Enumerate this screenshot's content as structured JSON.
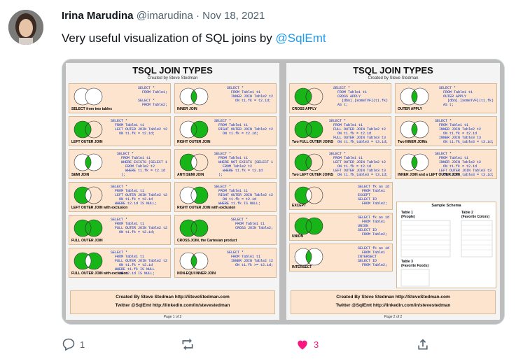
{
  "tweet": {
    "author_name": "Irina Marudina",
    "handle": "@imarudina",
    "dot": "·",
    "date": "Nov 18, 2021",
    "text_prefix": "Very useful visualization of SQL joins by ",
    "mention": "@SqlEmt"
  },
  "image": {
    "page1": {
      "title": "TSQL JOIN TYPES",
      "subtitle": "Created by Steve Stedman",
      "panels": [
        {
          "caption": "SELECT from two tables",
          "code": "SELECT *\n  FROM Table1;\n\nSELECT *\n  FROM Table2;"
        },
        {
          "caption": "INNER JOIN",
          "code": "SELECT *\n  FROM Table1 t1\n  INNER JOIN Table2 t2\n    ON t1.fk = t2.id;"
        },
        {
          "caption": "LEFT OUTER JOIN",
          "code": "SELECT *\n  FROM Table1 t1\n  LEFT OUTER JOIN Table2 t2\n    ON t1.fk = t2.id;"
        },
        {
          "caption": "RIGHT OUTER JOIN",
          "code": "SELECT *\n  FROM Table1 t1\n  RIGHT OUTER JOIN Table2 t2\n    ON t1.fk = t2.id;"
        },
        {
          "caption": "SEMI JOIN",
          "code": "SELECT *\n  FROM Table1 t1\n  WHERE EXISTS (SELECT 1\n    FROM Table2 t2\n    WHERE t1.fk = t2.id\n  );"
        },
        {
          "caption": "ANTI SEMI JOIN",
          "code": "SELECT *\n  FROM Table1 t1\n  WHERE NOT EXISTS (SELECT 1\n    FROM Table2 t2\n    WHERE t1.fk = t2.id\n  );"
        },
        {
          "caption": "LEFT OUTER JOIN with exclusion",
          "code": "SELECT *\n  FROM Table1 t1\n  LEFT OUTER JOIN Table2 t2\n    ON t1.fk = t2.id\n  WHERE t2.id IS NULL;"
        },
        {
          "caption": "RIGHT OUTER JOIN with exclusion",
          "code": "SELECT *\n  FROM Table1 t1\n  RIGHT OUTER JOIN Table2 t2\n    ON t1.fk = t2.id\n  WHERE t1.fk IS NULL;"
        },
        {
          "caption": "FULL OUTER JOIN",
          "code": "SELECT *\n  FROM Table1 t1\n  FULL OUTER JOIN Table2 t2\n    ON t1.fk = t2.id;"
        },
        {
          "caption": "CROSS JOIN, the Cartesian product",
          "code": "SELECT *\n  FROM Table1 t1\n  CROSS JOIN Table2;"
        },
        {
          "caption": "FULL OUTER JOIN with exclusion",
          "code": "SELECT *\n  FROM Table1 t1\n  FULL OUTER JOIN Table2 t2\n    ON t1.fk = t2.id\n  WHERE t1.fk IS NULL\n    OR t2.id IS NULL;"
        },
        {
          "caption": "NON-EQUI INNER JOIN",
          "code": "SELECT *\n  FROM Table1 t1\n  INNER JOIN Table2 t2\n    ON t1.fk >= t2.id;"
        }
      ],
      "footer_line1": "Created By Steve Stedman       http://SteveStedman.com",
      "footer_line2": "Twitter @SqlEmt     http://linkedin.com/in/stevestedman",
      "page_label": "Page 1 of 2"
    },
    "page2": {
      "title": "TSQL JOIN TYPES",
      "subtitle": "Created by Steve Stedman",
      "panels": [
        {
          "caption": "CROSS APPLY",
          "code": "SELECT *\n  FROM Table1 t1\n  CROSS APPLY\n    [dbo].[someTVF](t1.fk)\n  AS t;"
        },
        {
          "caption": "OUTER APPLY",
          "code": "SELECT *\n  FROM Table1 t1\n  OUTER APPLY\n    [dbo].[someTVF](t1.fk)\n  AS t;"
        },
        {
          "caption": "Two FULL OUTER JOINS",
          "code": "SELECT *\n  FROM Table1 t1\n  FULL OUTER JOIN Table2 t2\n    ON t1.fk = t2.id\n  FULL OUTER JOIN Table3 t3\n    ON t1.fk_table3 = t3.id;"
        },
        {
          "caption": "Two INNER JOINs",
          "code": "SELECT *\n  FROM Table1 t1\n  INNER JOIN Table2 t2\n    ON t1.fk = t2.id\n  INNER JOIN Table3 t3\n    ON t1.fk_table3 = t3.id;"
        },
        {
          "caption": "Two LEFT OUTER JOINS",
          "code": "SELECT *\n  FROM Table1 t1\n  LEFT OUTER JOIN Table2 t2\n    ON t1.fk = t2.id\n  LEFT OUTER JOIN Table3 t3\n    ON t1.fk_table3 = t3.id;"
        },
        {
          "caption": "INNER JOIN and a LEFT OUTER JOIN",
          "code": "SELECT *\n  FROM Table1 t1\n  INNER JOIN Table2 t2\n    ON t1.fk = t2.id\n  LEFT OUTER JOIN Table3 t3\n    ON t1.fk_table3 = t3.id;"
        },
        {
          "caption": "EXCEPT",
          "code": "SELECT fk as id\n  FROM Table1\nEXCEPT\nSELECT ID\n  FROM Table2;"
        },
        {
          "caption": "UNION",
          "code": "SELECT fk as id\n  FROM Table1\nUNION\nSELECT ID\n  FROM Table2;"
        },
        {
          "caption": "INTERSECT",
          "code": "SELECT fk as id\n  FROM Table1\nINTERSECT\nSELECT ID\n  FROM Table2;"
        }
      ],
      "schema_title": "Sample Schema",
      "schema_t1": "Table 1",
      "schema_t1_sub": "(People)",
      "schema_t2": "Table 2",
      "schema_t2_sub": "(Favorite Colors)",
      "schema_t3": "Table 3",
      "schema_t3_sub": "(Favorite Foods)",
      "footer_line1": "Created By Steve Stedman       http://SteveStedman.com",
      "footer_line2": "Twitter @SqlEmt     http://linkedin.com/in/stevestedman",
      "page_label": "Page 2 of 2"
    }
  },
  "actions": {
    "reply_count": "1",
    "retweet_count": "",
    "like_count": "3",
    "like_color": "#f91880"
  }
}
